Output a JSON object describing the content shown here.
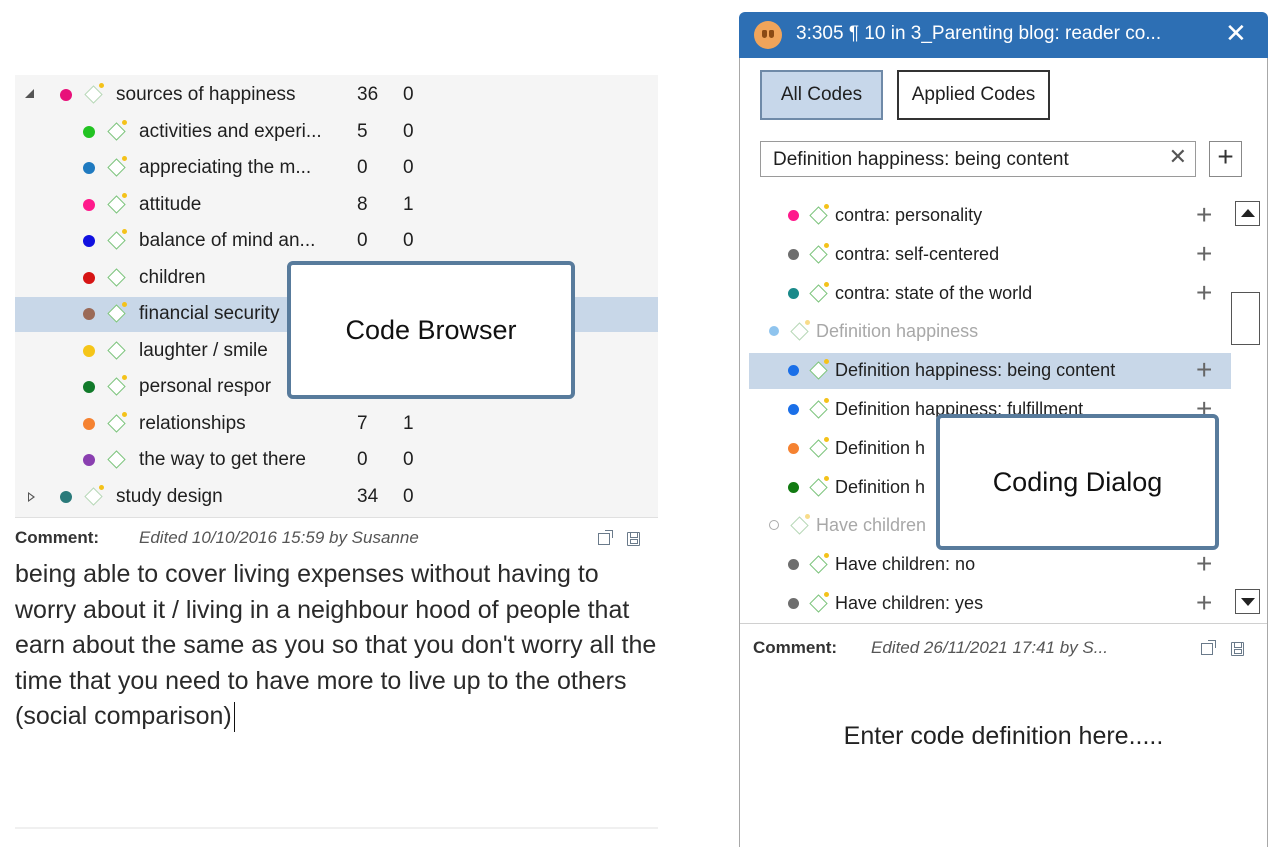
{
  "code_browser": {
    "rows": [
      {
        "label": "sources of happiness",
        "n1": "36",
        "n2": "0",
        "color": "#e8107a",
        "level": 0,
        "expander": "expanded",
        "faint": true
      },
      {
        "label": "activities and experi...",
        "n1": "5",
        "n2": "0",
        "color": "#22c322",
        "level": 1
      },
      {
        "label": "appreciating the m...",
        "n1": "0",
        "n2": "0",
        "color": "#1f7ac0",
        "level": 1
      },
      {
        "label": "attitude",
        "n1": "8",
        "n2": "1",
        "color": "#ff1a8c",
        "level": 1
      },
      {
        "label": "balance of mind an...",
        "n1": "0",
        "n2": "0",
        "color": "#1010e0",
        "level": 1
      },
      {
        "label": "children",
        "n1": "",
        "n2": "",
        "color": "#d61414",
        "level": 1,
        "nospark": true
      },
      {
        "label": "financial security",
        "n1": "",
        "n2": "",
        "color": "#9b6a57",
        "level": 1,
        "selected": true
      },
      {
        "label": "laughter / smile",
        "n1": "",
        "n2": "",
        "color": "#f5c518",
        "level": 1,
        "nospark": true
      },
      {
        "label": "personal respor",
        "n1": "",
        "n2": "",
        "color": "#117a2a",
        "level": 1
      },
      {
        "label": "relationships",
        "n1": "7",
        "n2": "1",
        "color": "#f58231",
        "level": 1
      },
      {
        "label": "the way to get there",
        "n1": "0",
        "n2": "0",
        "color": "#8a3fb0",
        "level": 1,
        "nospark": true
      },
      {
        "label": "study design",
        "n1": "34",
        "n2": "0",
        "color": "#2a7a7a",
        "level": 0,
        "expander": "collapsed",
        "faint": true
      }
    ],
    "comment": {
      "label": "Comment:",
      "meta": "Edited 10/10/2016 15:59 by Susanne",
      "text": "being able to cover living expenses without having to worry about it / living in a neighbour hood of people that earn about the same as you so that you don't worry all the time that you need to have more to live up to the others (social comparison)"
    },
    "callout": "Code Browser"
  },
  "coding_dialog": {
    "title": "3:305 ¶ 10 in 3_Parenting blog: reader co...",
    "close": "✕",
    "tabs": [
      {
        "label": "All Codes",
        "active": true
      },
      {
        "label": "Applied Codes",
        "active": false
      }
    ],
    "search": {
      "value": "Definition happiness: being content",
      "clear": "✕"
    },
    "add": "+",
    "rows": [
      {
        "label": "contra: personality",
        "color": "#ff1a8c",
        "plus": true
      },
      {
        "label": "contra: self-centered",
        "color": "#6e6e6e",
        "plus": true
      },
      {
        "label": "contra: state of the world",
        "color": "#1a8a8a",
        "plus": true
      },
      {
        "label": "Definition happiness",
        "color": "#8fc4ee",
        "group": true
      },
      {
        "label": "Definition happiness: being content",
        "color": "#1a6fe8",
        "plus": true,
        "selected": true
      },
      {
        "label": "Definition happiness: fulfillment",
        "color": "#1a6fe8",
        "plus": true
      },
      {
        "label": "Definition h",
        "color": "#f58231",
        "plus": false
      },
      {
        "label": "Definition h",
        "color": "#117a11",
        "plus": false
      },
      {
        "label": "Have children",
        "color": "#ffffff",
        "group": true,
        "hollow": true
      },
      {
        "label": "Have children: no",
        "color": "#6e6e6e",
        "plus": true
      },
      {
        "label": "Have children: yes",
        "color": "#6e6e6e",
        "plus": true
      }
    ],
    "comment": {
      "label": "Comment:",
      "meta": "Edited 26/11/2021 17:41 by S...",
      "placeholder": "Enter code definition here....."
    },
    "callout": "Coding Dialog"
  }
}
